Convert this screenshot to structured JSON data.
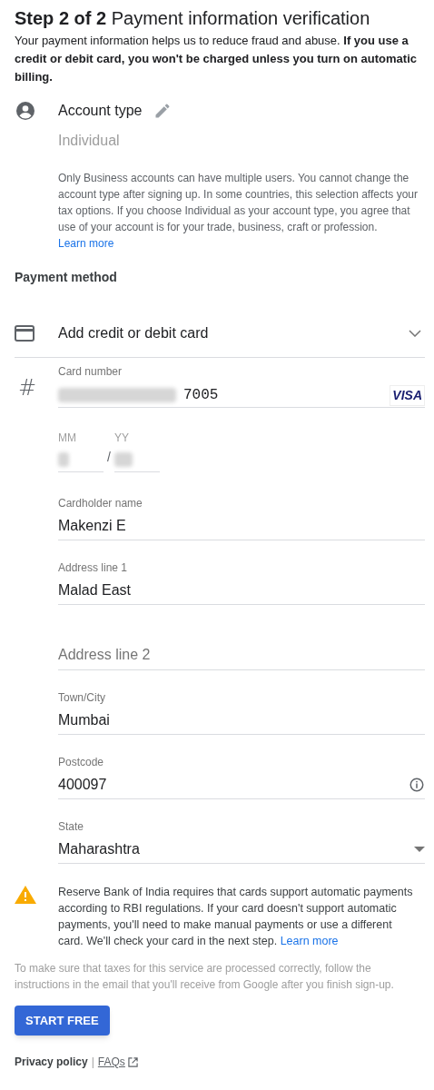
{
  "header": {
    "step": "Step 2 of 2",
    "title": "Payment information verification",
    "intro": "Your payment information helps us to reduce fraud and abuse. **If you use a credit or debit card, you won't be charged unless you turn on automatic billing.**"
  },
  "account_type": {
    "label": "Account type",
    "value": "Individual",
    "note": "Only Business accounts can have multiple users. You cannot change the account type after signing up. In some countries, this selection affects your tax options. If you choose Individual as your account type, you agree that use of your account is for your trade, business, craft or profession.",
    "note_link": "Learn more"
  },
  "payment_method": {
    "heading": "Payment method",
    "selector": "Add credit or debit card"
  },
  "card_number": {
    "symbol": "#",
    "label": "Card number",
    "value_visible": "7005",
    "brand": "VISA"
  },
  "expiry": {
    "month_label": "MM",
    "year_label": "YY",
    "separator": "/"
  },
  "fields": [
    {
      "kind": "text",
      "label": "Cardholder name",
      "value": "Makenzi E"
    },
    {
      "kind": "text",
      "label": "Address line 1",
      "value": "Malad East"
    },
    {
      "kind": "text",
      "placeholder": "Address line 2"
    },
    {
      "kind": "text",
      "label": "Town/City",
      "value": "Mumbai"
    },
    {
      "kind": "info",
      "label": "Postcode",
      "value": "400097"
    },
    {
      "kind": "select",
      "label": "State",
      "value": "Maharashtra"
    }
  ],
  "notice": {
    "text": "Reserve Bank of India requires that cards support automatic payments according to RBI regulations. If your card doesn't support automatic payments, you'll need to make manual payments or use a different card. We'll check your card in the next step.",
    "link": "Learn more"
  },
  "tax_note": "To make sure that taxes for this service are processed correctly, follow the instructions in the email that you'll receive from Google after you finish sign-up.",
  "start_button": "START FREE",
  "footer": {
    "privacy": "Privacy policy",
    "separator": "|",
    "faqs": "FAQs"
  }
}
